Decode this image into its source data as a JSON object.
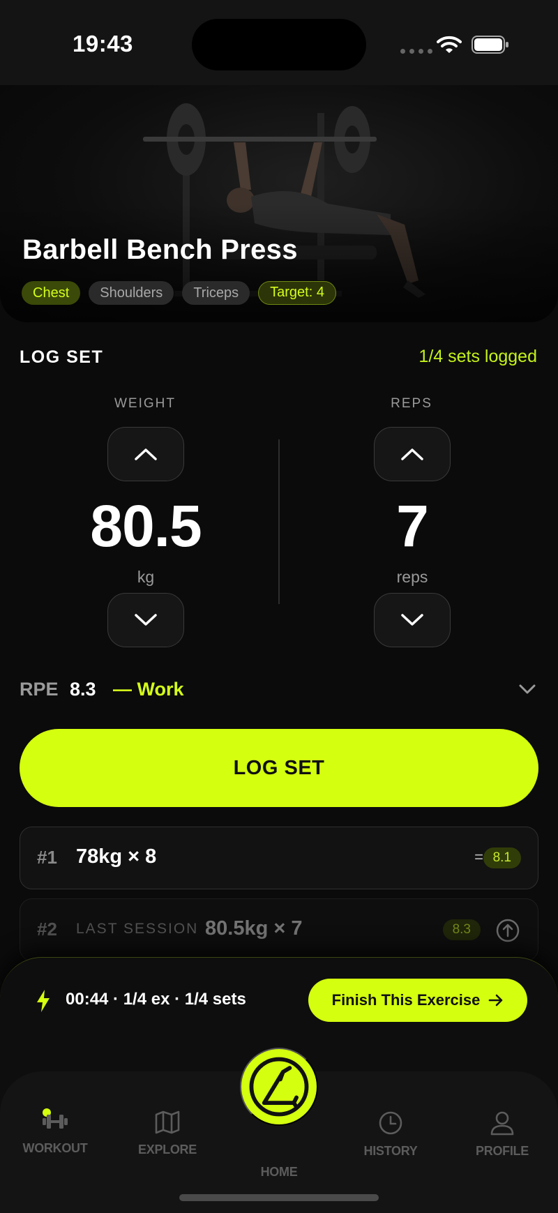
{
  "status_bar": {
    "time": "19:43"
  },
  "exercise": {
    "title": "Barbell Bench Press",
    "tags": [
      "Chest",
      "Shoulders",
      "Triceps"
    ],
    "target": "Target: 4"
  },
  "log": {
    "header": "LOG SET",
    "progress": "1/4 sets logged",
    "weight": {
      "label": "WEIGHT",
      "value": "80.5",
      "unit": "kg"
    },
    "reps": {
      "label": "REPS",
      "value": "7",
      "unit": "reps"
    },
    "rpe": {
      "label": "RPE",
      "value": "8.3",
      "zone": "— Work"
    },
    "button_label": "LOG SET"
  },
  "sets": [
    {
      "number": "#1",
      "summary": "78kg × 8",
      "indicator": "=",
      "rpe": "8.1"
    },
    {
      "number": "#2",
      "note": "LAST SESSION",
      "summary": "80.5kg × 7",
      "rpe": "8.3"
    }
  ],
  "session": {
    "stats": "00:44 · 1/4 ex · 1/4 sets",
    "finish_label": "Finish This Exercise"
  },
  "tabs": [
    {
      "label": "WORKOUT",
      "icon": "dumbbell-icon",
      "active": true
    },
    {
      "label": "EXPLORE",
      "icon": "map-icon"
    },
    {
      "label": "HOME",
      "icon": "home-logo-icon"
    },
    {
      "label": "HISTORY",
      "icon": "clock-icon"
    },
    {
      "label": "PROFILE",
      "icon": "user-icon"
    }
  ],
  "colors": {
    "accent": "#d4ff0f",
    "background": "#0b0b0b"
  }
}
